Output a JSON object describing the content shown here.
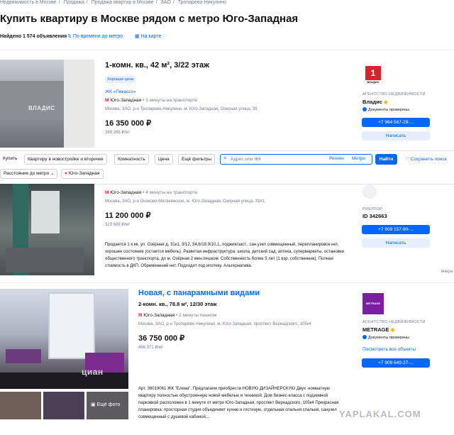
{
  "breadcrumbs": [
    "Недвижимость в Москве",
    "Продажа",
    "Продажа квартир в Москве",
    "ЗАО",
    "Тропарево-Никулино"
  ],
  "page_title": "Купить квартиру в Москве рядом с метро Юго-Западная",
  "found_text": "Найдено 1 574 объявления",
  "sort_label": "По времени до метро",
  "map_label": "На карте",
  "filters": {
    "buy": "Купить",
    "flat_type": "Квартиру в новостройке и вторичке",
    "rooms": "Комнатность",
    "price": "Цена",
    "more": "Ещё фильтры",
    "search_placeholder": "Адрес или ЖК",
    "region": "Регион",
    "metro": "Метро",
    "find": "Найти",
    "save_search": "Сохранить поиск",
    "chip_distance": "Расстояние до метро",
    "chip_metro": "Юго-Западная"
  },
  "listings": [
    {
      "title": "1-комн. кв., 42 м², 3/22 этаж",
      "tag": "Хорошая цена",
      "complex": "ЖК «Пикассо»",
      "metro": "Юго-Западная",
      "metro_time": "3 минуты на транспорте",
      "address": "Москва, ЗАО, р-н Тропарево-Никулино, м. Юго-Западная, Озерная улица, 35",
      "price": "16 350 000 ₽",
      "price_per_m": "389 286 ₽/м²",
      "agency_caption": "АГЕНТСТВО НЕДВИЖИМОСТИ",
      "agency_name": "Владис",
      "agency_logo": "ВЛАДИС",
      "verified": "Документы проверены",
      "phone": "+7 964 567-29-...",
      "write": "Написать",
      "photo_watermark": "ВЛАДИС"
    },
    {
      "metro": "Юго-Западная",
      "metro_time": "4 минуты на транспорте",
      "address": "Москва, ЗАО, р-н Очаково-Матвеевское, м. Юго-Западная, Озерная улица, 31К1",
      "price": "11 200 000 ₽",
      "price_per_m": "323 699 ₽/м²",
      "description": "Продается 1 к.кв. ул. Озёрная д. 31к1, 3/12, 34,6/18,9/10,1, лоджия/заст., сан.узел совмещенный, перепланировок нет, хорошее состояние (остается мебель). Развитая инфраструктура: школа, детский сад, аптека, супермаркеты, остановки общественного транспорта, до м. Озёрная 2 мин.пешком. Собственность более 5 лет (1 взр. собственник). Полная стоимость в ДКП. Обременений нет. Подходит под ипотеку. Альтернатива.",
      "agency_caption": "РИЕЛТОР",
      "agency_name": "ID 342663",
      "phone": "+7 909 157-90-...",
      "write": "Написать",
      "date": "вчера"
    },
    {
      "title": "Новая, с панарамными видами",
      "subtitle": "2-комн. кв., 78.8 м², 12/30 этаж",
      "metro": "Юго-Западная",
      "metro_time": "2 минуты пешком",
      "address": "Москва, ЗАО, р-н Тропарево-Никулино, м. Юго-Западная, проспект Вернадского, 105к4",
      "price": "36 750 000 ₽",
      "price_per_m": "466 371 ₽/м²",
      "description": "Арт. 36019061 ЖК \"Елена\". Предлагаем приобрести НОВУЮ ДИЗАЙНЕРСКУЮ Двух -комнатную квартиру полностью обустроенную новой мебелью и техникой. Дом бизнес-класса с подземной парковкой расположен в 1 минуте от метро Юго-Западная, проспект Вернадского, 105к4 Прекрасная планировка: просторная студия объединяет кухню и гостиную, отдельная спальня спальня, санузел совмещенный с душевой кабиной,...",
      "agency_caption": "АГЕНТСТВО НЕДВИЖИМОСТИ",
      "agency_name": "METRAGE",
      "agency_logo": "METRAGE",
      "verified": "Документы проверены",
      "all_listings": "Посмотреть все объекты",
      "phone": "+7 909 649-27-...",
      "more_photo": "Ещё фото",
      "photo_watermark": "циан"
    }
  ],
  "site_watermark": "YAPLAKAL.COM",
  "colors": {
    "accent": "#0468ff",
    "metro": "#ff1f34",
    "muted": "#737a8e"
  }
}
